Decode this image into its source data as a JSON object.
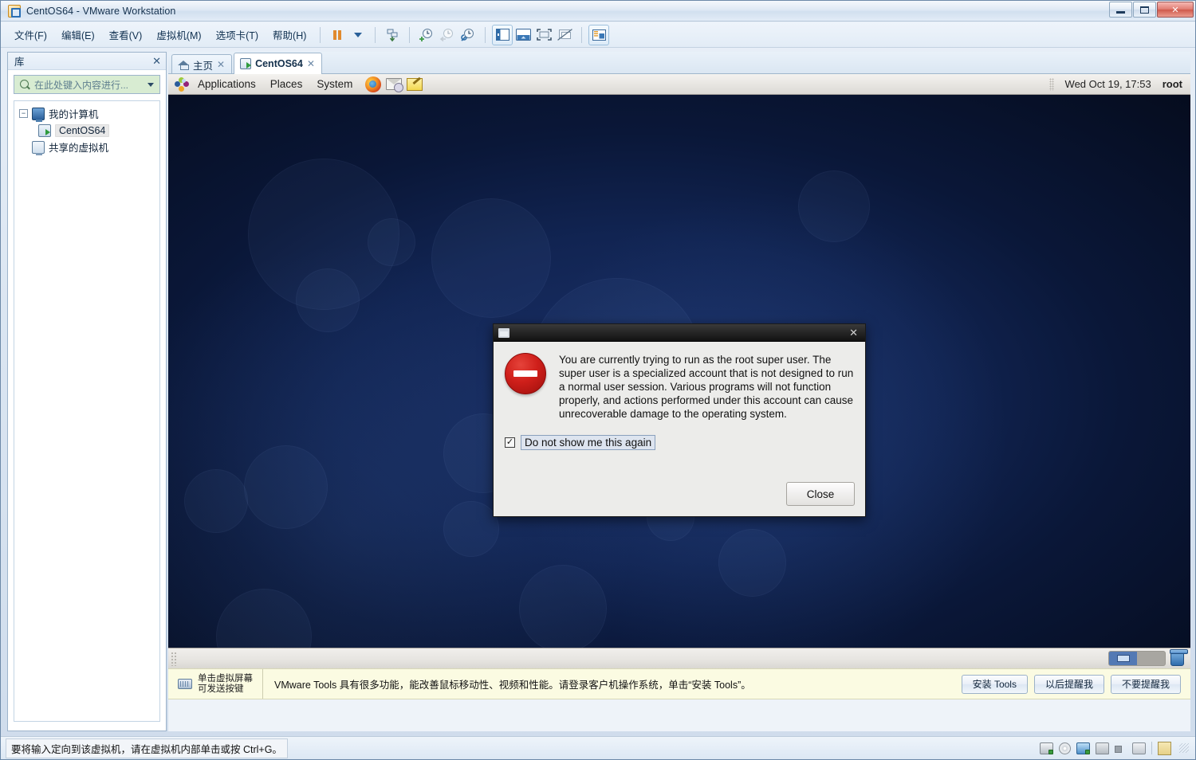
{
  "window": {
    "title": "CentOS64 - VMware Workstation",
    "app_icon": "vmware-icon",
    "minimize": "minimize-icon",
    "maximize": "maximize-icon",
    "close": "close-icon"
  },
  "menubar": {
    "items": [
      {
        "label": "文件(F)",
        "name": "menu-file"
      },
      {
        "label": "编辑(E)",
        "name": "menu-edit"
      },
      {
        "label": "查看(V)",
        "name": "menu-view"
      },
      {
        "label": "虚拟机(M)",
        "name": "menu-vm"
      },
      {
        "label": "选项卡(T)",
        "name": "menu-tabs"
      },
      {
        "label": "帮助(H)",
        "name": "menu-help"
      }
    ],
    "toolbar_icons": [
      "pause-icon",
      "dropdown-caret-icon",
      "power-icon",
      "snapshot-take-icon",
      "snapshot-revert-icon",
      "snapshot-manager-icon",
      "show-library-icon",
      "show-thumbnails-icon",
      "full-screen-icon",
      "unity-icon",
      "console-view-icon"
    ]
  },
  "library": {
    "title": "库",
    "close_label": "✕",
    "search": {
      "placeholder": "在此处键入内容进行...",
      "value": ""
    },
    "tree": [
      {
        "label": "我的计算机",
        "icon": "my-computer-icon",
        "level": 0,
        "expanded": true
      },
      {
        "label": "CentOS64",
        "icon": "virtual-machine-icon",
        "level": 1,
        "selected": true
      },
      {
        "label": "共享的虚拟机",
        "icon": "shared-vms-icon",
        "level": 0
      }
    ]
  },
  "tabs": [
    {
      "label": "主页",
      "icon": "home-icon",
      "active": false,
      "close": "✕"
    },
    {
      "label": "CentOS64",
      "icon": "virtual-machine-icon",
      "active": true,
      "close": "✕"
    }
  ],
  "guest": {
    "panel_top": {
      "logo": "centos-logo-icon",
      "menus": [
        "Applications",
        "Places",
        "System"
      ],
      "launchers": [
        "firefox-icon",
        "evolution-mail-icon",
        "gedit-icon"
      ],
      "clock": "Wed Oct 19, 17:53",
      "user": "root"
    },
    "panel_bottom": {
      "workspaces": 2,
      "active_workspace": 1,
      "trash": "trash-icon"
    }
  },
  "dialog": {
    "title": "",
    "icon": "error-icon",
    "close": "✕",
    "message": "You are currently trying to run as the root super user.  The super user is a specialized account that is not designed to run a normal user session.  Various programs will not function properly, and actions performed under this account can cause unrecoverable damage to the operating system.",
    "checkbox": {
      "label": "Do not show me this again",
      "checked": true,
      "mark": "✓"
    },
    "buttons": [
      {
        "label": "Close",
        "name": "close-button"
      }
    ]
  },
  "tools_bar": {
    "hint_line1": "单击虚拟屏幕",
    "hint_line2": "可发送按键",
    "hint_icon": "keyboard-icon",
    "message": "VMware Tools 具有很多功能，能改善鼠标移动性、视频和性能。请登录客户机操作系统，单击“安装 Tools”。",
    "buttons": [
      {
        "label": "安装 Tools",
        "name": "install-tools-button"
      },
      {
        "label": "以后提醒我",
        "name": "remind-me-later-button"
      },
      {
        "label": "不要提醒我",
        "name": "never-remind-button"
      }
    ]
  },
  "statusbar": {
    "message": "要将输入定向到该虚拟机，请在虚拟机内部单击或按 Ctrl+G。",
    "devices": [
      "hard-disk-icon",
      "cd-dvd-icon",
      "network-adapter-icon",
      "printer-icon",
      "sound-card-icon",
      "display-icon",
      "usb-note-icon"
    ]
  },
  "colors": {
    "accent": "#2a6fb5",
    "tools_bar_bg": "#fbfbe2",
    "error_red": "#cf1f1a",
    "search_bg": "#d8ecd2",
    "wallpaper": "#112452"
  }
}
